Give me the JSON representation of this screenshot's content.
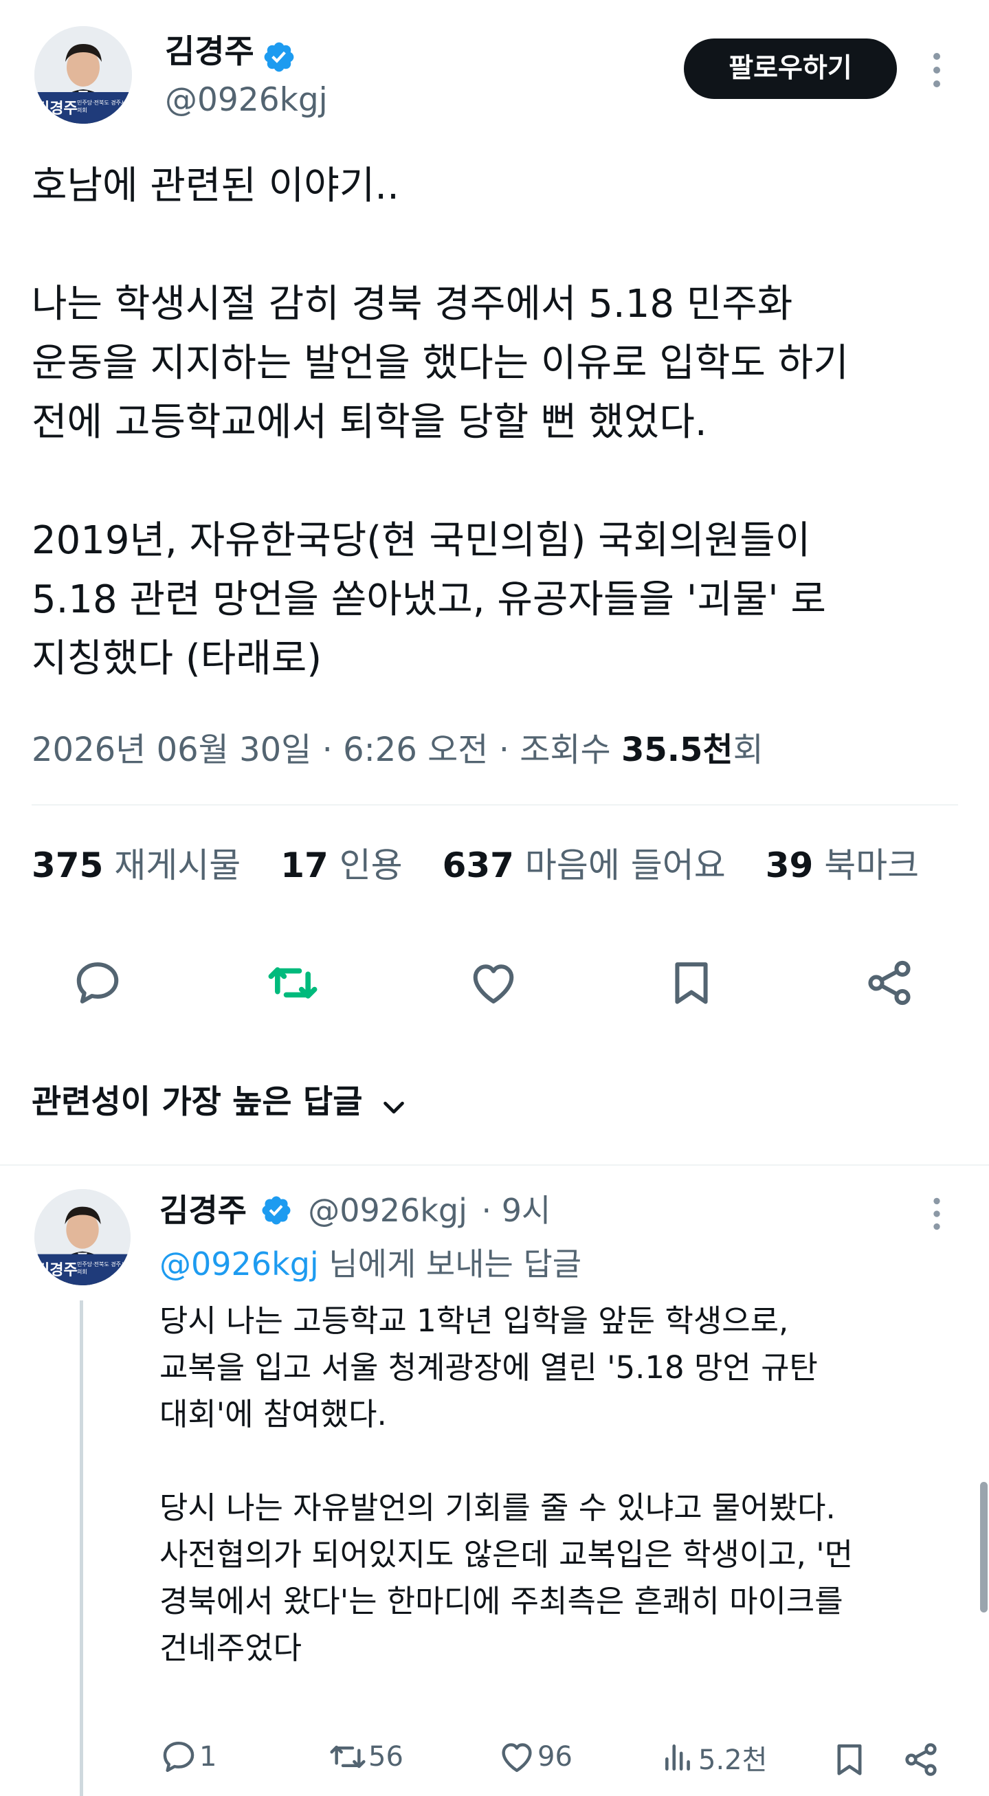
{
  "tweet": {
    "author_name": "김경주",
    "author_handle": "@0926kgj",
    "avatar_caption": "김경주",
    "avatar_sub": "민주당·전북도 경주시의회",
    "follow_label": "팔로우하기",
    "text": "호남에 관련된 이야기..\n\n나는 학생시절 감히 경북 경주에서 5.18 민주화\n운동을 지지하는 발언을 했다는 이유로 입학도 하기\n전에 고등학교에서 퇴학을 당할 뻔 했었다.\n\n2019년, 자유한국당(현 국민의힘) 국회의원들이\n5.18 관련 망언을 쏟아냈고, 유공자들을 '괴물' 로\n지칭했다 (타래로)",
    "date_text": "2026년 06월 30일 · 6:26 오전 · 조회수 ",
    "views_value": "35.5천",
    "views_suffix": "회",
    "stats": {
      "retweets_count": "375",
      "retweets_label": "재게시물",
      "quotes_count": "17",
      "quotes_label": "인용",
      "likes_count": "637",
      "likes_label": "마음에 들어요",
      "bookmarks_count": "39",
      "bookmarks_label": "북마크"
    }
  },
  "replies_header": {
    "label": "관련성이 가장 높은 답글"
  },
  "reply": {
    "author_name": "김경주",
    "author_handle": "@0926kgj",
    "time": "· 9시",
    "replying_to_handle": "@0926kgj",
    "replying_to_suffix": " 님에게 보내는 답글",
    "text": "당시 나는 고등학교 1학년 입학을 앞둔 학생으로,\n교복을 입고 서울 청계광장에 열린 '5.18 망언 규탄\n대회'에 참여했다.\n\n당시 나는 자유발언의 기회를 줄 수 있냐고 물어봤다.\n사전협의가 되어있지도 않은데 교복입은 학생이고, '먼\n경북에서 왔다'는 한마디에 주최측은 흔쾌히 마이크를\n건네주었다",
    "actions": {
      "replies": "1",
      "retweets": "56",
      "likes": "96",
      "views": "5.2천"
    }
  },
  "colors": {
    "text": "#0f1419",
    "secondary": "#536471",
    "accent": "#1d9bf0",
    "retweet_active": "#00ba7c",
    "divider": "#eff3f4"
  }
}
